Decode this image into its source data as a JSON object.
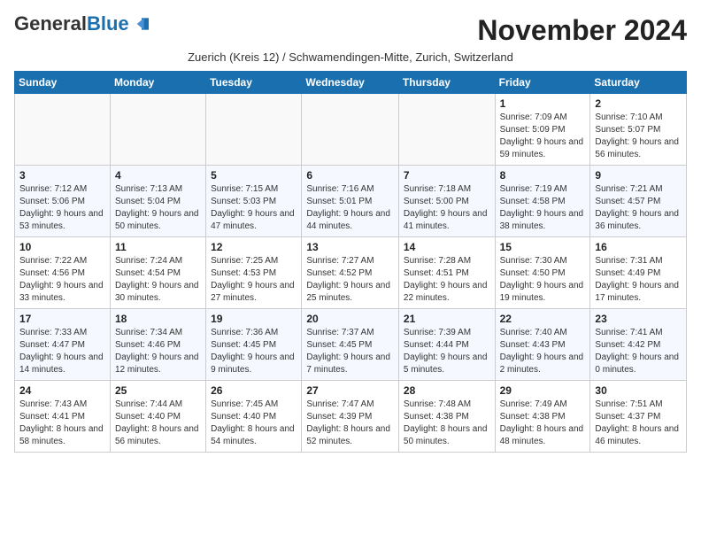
{
  "header": {
    "logo_general": "General",
    "logo_blue": "Blue",
    "month_title": "November 2024",
    "subtitle": "Zuerich (Kreis 12) / Schwamendingen-Mitte, Zurich, Switzerland"
  },
  "days_of_week": [
    "Sunday",
    "Monday",
    "Tuesday",
    "Wednesday",
    "Thursday",
    "Friday",
    "Saturday"
  ],
  "weeks": [
    {
      "days": [
        {
          "num": "",
          "info": ""
        },
        {
          "num": "",
          "info": ""
        },
        {
          "num": "",
          "info": ""
        },
        {
          "num": "",
          "info": ""
        },
        {
          "num": "",
          "info": ""
        },
        {
          "num": "1",
          "sunrise": "Sunrise: 7:09 AM",
          "sunset": "Sunset: 5:09 PM",
          "daylight": "Daylight: 9 hours and 59 minutes."
        },
        {
          "num": "2",
          "sunrise": "Sunrise: 7:10 AM",
          "sunset": "Sunset: 5:07 PM",
          "daylight": "Daylight: 9 hours and 56 minutes."
        }
      ]
    },
    {
      "days": [
        {
          "num": "3",
          "sunrise": "Sunrise: 7:12 AM",
          "sunset": "Sunset: 5:06 PM",
          "daylight": "Daylight: 9 hours and 53 minutes."
        },
        {
          "num": "4",
          "sunrise": "Sunrise: 7:13 AM",
          "sunset": "Sunset: 5:04 PM",
          "daylight": "Daylight: 9 hours and 50 minutes."
        },
        {
          "num": "5",
          "sunrise": "Sunrise: 7:15 AM",
          "sunset": "Sunset: 5:03 PM",
          "daylight": "Daylight: 9 hours and 47 minutes."
        },
        {
          "num": "6",
          "sunrise": "Sunrise: 7:16 AM",
          "sunset": "Sunset: 5:01 PM",
          "daylight": "Daylight: 9 hours and 44 minutes."
        },
        {
          "num": "7",
          "sunrise": "Sunrise: 7:18 AM",
          "sunset": "Sunset: 5:00 PM",
          "daylight": "Daylight: 9 hours and 41 minutes."
        },
        {
          "num": "8",
          "sunrise": "Sunrise: 7:19 AM",
          "sunset": "Sunset: 4:58 PM",
          "daylight": "Daylight: 9 hours and 38 minutes."
        },
        {
          "num": "9",
          "sunrise": "Sunrise: 7:21 AM",
          "sunset": "Sunset: 4:57 PM",
          "daylight": "Daylight: 9 hours and 36 minutes."
        }
      ]
    },
    {
      "days": [
        {
          "num": "10",
          "sunrise": "Sunrise: 7:22 AM",
          "sunset": "Sunset: 4:56 PM",
          "daylight": "Daylight: 9 hours and 33 minutes."
        },
        {
          "num": "11",
          "sunrise": "Sunrise: 7:24 AM",
          "sunset": "Sunset: 4:54 PM",
          "daylight": "Daylight: 9 hours and 30 minutes."
        },
        {
          "num": "12",
          "sunrise": "Sunrise: 7:25 AM",
          "sunset": "Sunset: 4:53 PM",
          "daylight": "Daylight: 9 hours and 27 minutes."
        },
        {
          "num": "13",
          "sunrise": "Sunrise: 7:27 AM",
          "sunset": "Sunset: 4:52 PM",
          "daylight": "Daylight: 9 hours and 25 minutes."
        },
        {
          "num": "14",
          "sunrise": "Sunrise: 7:28 AM",
          "sunset": "Sunset: 4:51 PM",
          "daylight": "Daylight: 9 hours and 22 minutes."
        },
        {
          "num": "15",
          "sunrise": "Sunrise: 7:30 AM",
          "sunset": "Sunset: 4:50 PM",
          "daylight": "Daylight: 9 hours and 19 minutes."
        },
        {
          "num": "16",
          "sunrise": "Sunrise: 7:31 AM",
          "sunset": "Sunset: 4:49 PM",
          "daylight": "Daylight: 9 hours and 17 minutes."
        }
      ]
    },
    {
      "days": [
        {
          "num": "17",
          "sunrise": "Sunrise: 7:33 AM",
          "sunset": "Sunset: 4:47 PM",
          "daylight": "Daylight: 9 hours and 14 minutes."
        },
        {
          "num": "18",
          "sunrise": "Sunrise: 7:34 AM",
          "sunset": "Sunset: 4:46 PM",
          "daylight": "Daylight: 9 hours and 12 minutes."
        },
        {
          "num": "19",
          "sunrise": "Sunrise: 7:36 AM",
          "sunset": "Sunset: 4:45 PM",
          "daylight": "Daylight: 9 hours and 9 minutes."
        },
        {
          "num": "20",
          "sunrise": "Sunrise: 7:37 AM",
          "sunset": "Sunset: 4:45 PM",
          "daylight": "Daylight: 9 hours and 7 minutes."
        },
        {
          "num": "21",
          "sunrise": "Sunrise: 7:39 AM",
          "sunset": "Sunset: 4:44 PM",
          "daylight": "Daylight: 9 hours and 5 minutes."
        },
        {
          "num": "22",
          "sunrise": "Sunrise: 7:40 AM",
          "sunset": "Sunset: 4:43 PM",
          "daylight": "Daylight: 9 hours and 2 minutes."
        },
        {
          "num": "23",
          "sunrise": "Sunrise: 7:41 AM",
          "sunset": "Sunset: 4:42 PM",
          "daylight": "Daylight: 9 hours and 0 minutes."
        }
      ]
    },
    {
      "days": [
        {
          "num": "24",
          "sunrise": "Sunrise: 7:43 AM",
          "sunset": "Sunset: 4:41 PM",
          "daylight": "Daylight: 8 hours and 58 minutes."
        },
        {
          "num": "25",
          "sunrise": "Sunrise: 7:44 AM",
          "sunset": "Sunset: 4:40 PM",
          "daylight": "Daylight: 8 hours and 56 minutes."
        },
        {
          "num": "26",
          "sunrise": "Sunrise: 7:45 AM",
          "sunset": "Sunset: 4:40 PM",
          "daylight": "Daylight: 8 hours and 54 minutes."
        },
        {
          "num": "27",
          "sunrise": "Sunrise: 7:47 AM",
          "sunset": "Sunset: 4:39 PM",
          "daylight": "Daylight: 8 hours and 52 minutes."
        },
        {
          "num": "28",
          "sunrise": "Sunrise: 7:48 AM",
          "sunset": "Sunset: 4:38 PM",
          "daylight": "Daylight: 8 hours and 50 minutes."
        },
        {
          "num": "29",
          "sunrise": "Sunrise: 7:49 AM",
          "sunset": "Sunset: 4:38 PM",
          "daylight": "Daylight: 8 hours and 48 minutes."
        },
        {
          "num": "30",
          "sunrise": "Sunrise: 7:51 AM",
          "sunset": "Sunset: 4:37 PM",
          "daylight": "Daylight: 8 hours and 46 minutes."
        }
      ]
    }
  ]
}
